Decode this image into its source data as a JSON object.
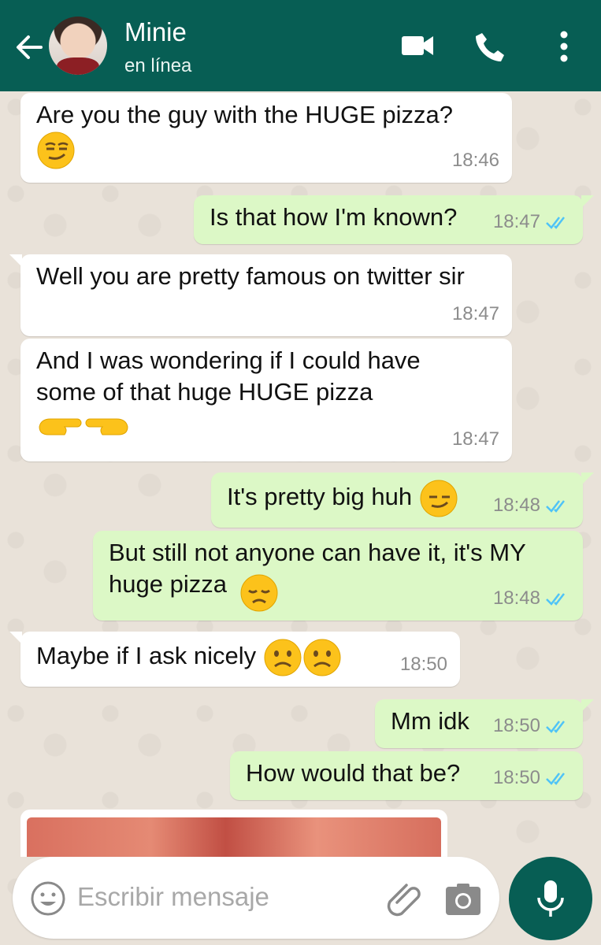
{
  "header": {
    "contact_name": "Minie",
    "status": "en línea",
    "bg_color": "#075e54"
  },
  "messages": [
    {
      "direction": "in",
      "text": "Are you the guy with the HUGE pizza?",
      "emoji": [
        "smirk"
      ],
      "time": "18:46"
    },
    {
      "direction": "out",
      "text": "Is that how I'm known?",
      "time": "18:47",
      "read": true
    },
    {
      "direction": "in",
      "text": "Well you are pretty famous on twitter sir",
      "time": "18:47"
    },
    {
      "direction": "in",
      "text": "And I was wondering if I could have some of that huge HUGE pizza",
      "emoji": [
        "pointing-right",
        "pointing-left"
      ],
      "time": "18:47"
    },
    {
      "direction": "out",
      "text": "It's pretty big huh",
      "emoji": [
        "smirk"
      ],
      "time": "18:48",
      "read": true
    },
    {
      "direction": "out",
      "text": "But still not anyone can have it, it's MY huge pizza",
      "emoji": [
        "disappointed"
      ],
      "time": "18:48",
      "read": true
    },
    {
      "direction": "in",
      "text": "Maybe if I ask nicely",
      "emoji": [
        "frowning",
        "frowning"
      ],
      "time": "18:50"
    },
    {
      "direction": "out",
      "text": "Mm idk",
      "time": "18:50",
      "read": true
    },
    {
      "direction": "out",
      "text": "How would that be?",
      "time": "18:50",
      "read": true
    }
  ],
  "input": {
    "placeholder": "Escribir mensaje"
  },
  "colors": {
    "incoming": "#ffffff",
    "outgoing": "#dcf8c6",
    "read_ticks": "#4fc3f7"
  },
  "icons": [
    "back-arrow-icon",
    "video-call-icon",
    "phone-icon",
    "more-options-icon",
    "emoji-icon",
    "attach-icon",
    "camera-icon",
    "mic-icon"
  ]
}
